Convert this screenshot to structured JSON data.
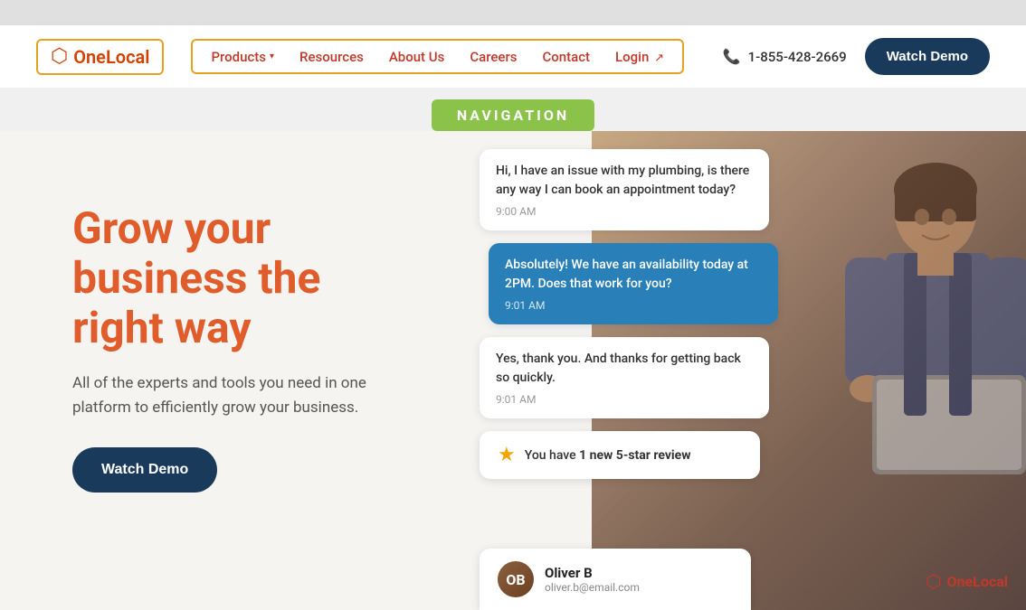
{
  "topBar": {},
  "navbar": {
    "logo": {
      "text_one": "One",
      "text_local": "Local",
      "icon": "⬡"
    },
    "navLinks": [
      {
        "id": "products",
        "label": "Products",
        "hasDropdown": true
      },
      {
        "id": "resources",
        "label": "Resources",
        "hasDropdown": false
      },
      {
        "id": "about",
        "label": "About Us",
        "hasDropdown": false
      },
      {
        "id": "careers",
        "label": "Careers",
        "hasDropdown": false
      },
      {
        "id": "contact",
        "label": "Contact",
        "hasDropdown": false
      },
      {
        "id": "login",
        "label": "Login",
        "hasDropdown": false
      }
    ],
    "phone": "1-855-428-2669",
    "watchDemoLabel": "Watch Demo"
  },
  "navBadge": {
    "label": "NAVIGATION"
  },
  "hero": {
    "title": "Grow your business the right way",
    "subtitle": "All of the experts and tools you need in one platform to efficiently grow your business.",
    "watchDemoLabel": "Watch Demo"
  },
  "chat": {
    "messages": [
      {
        "id": 1,
        "type": "white",
        "text": "Hi, I have an issue with my plumbing, is there any way I can book an appointment today?",
        "time": "9:00 AM"
      },
      {
        "id": 2,
        "type": "blue",
        "text": "Absolutely! We have an availability today at 2PM. Does that work for you?",
        "time": "9:01 AM"
      },
      {
        "id": 3,
        "type": "white",
        "text": "Yes, thank you. And thanks for getting back so quickly.",
        "time": "9:01 AM"
      }
    ],
    "review": {
      "text_prefix": "You have ",
      "highlight": "1 new 5-star review"
    }
  },
  "oliverCard": {
    "name": "Oliver B",
    "email": "oliver.b@email.com",
    "initials": "OB"
  },
  "watermark": {
    "icon": "⬡",
    "text_one": "One",
    "text_local": "Local"
  }
}
